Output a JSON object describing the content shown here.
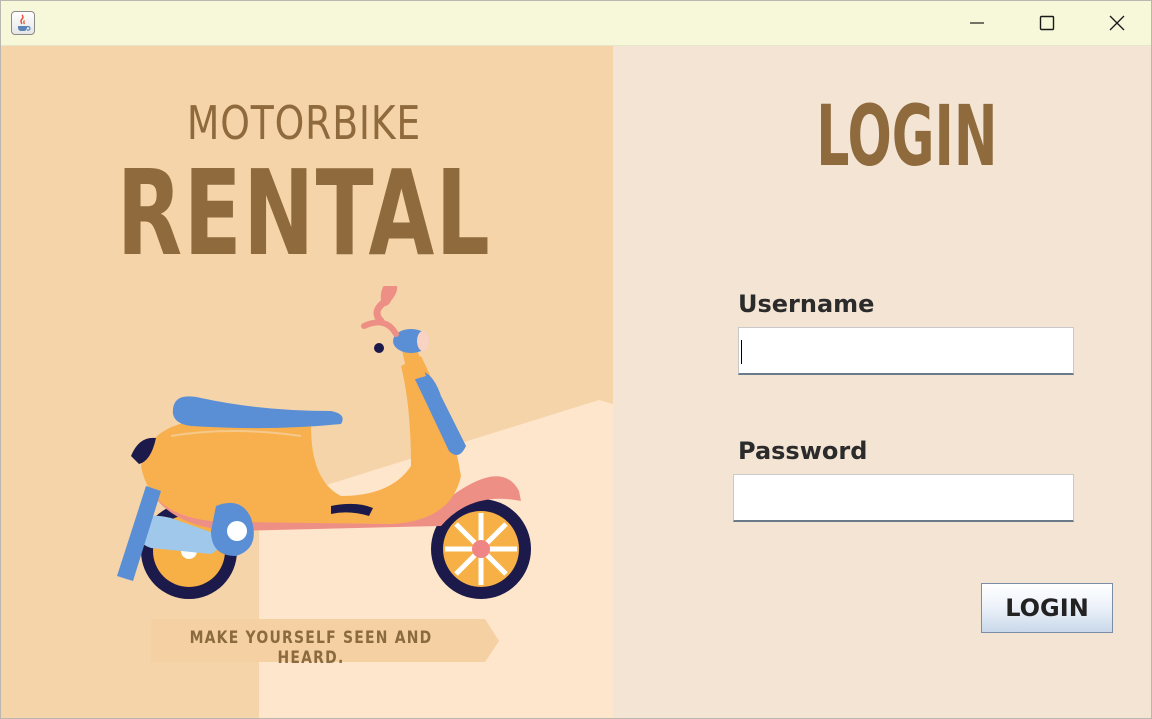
{
  "window": {
    "title": "",
    "icons": {
      "app": "java-app-icon",
      "minimize": "minimize-icon",
      "maximize": "maximize-icon",
      "close": "close-icon"
    }
  },
  "promo": {
    "title_small": "MOTORBIKE",
    "title_big": "RENTAL",
    "tagline": "MAKE YOURSELF SEEN AND HEARD.",
    "illustration": "scooter-illustration",
    "colors": {
      "background": "#f5d4aa",
      "light_band": "#fde6cc",
      "title": "#8f6a3c"
    }
  },
  "login": {
    "heading": "LOGIN",
    "username_label": "Username",
    "username_value": "",
    "password_label": "Password",
    "password_value": "",
    "button_label": "LOGIN",
    "colors": {
      "background": "#f3e4d4",
      "heading": "#8f6a3c"
    }
  }
}
